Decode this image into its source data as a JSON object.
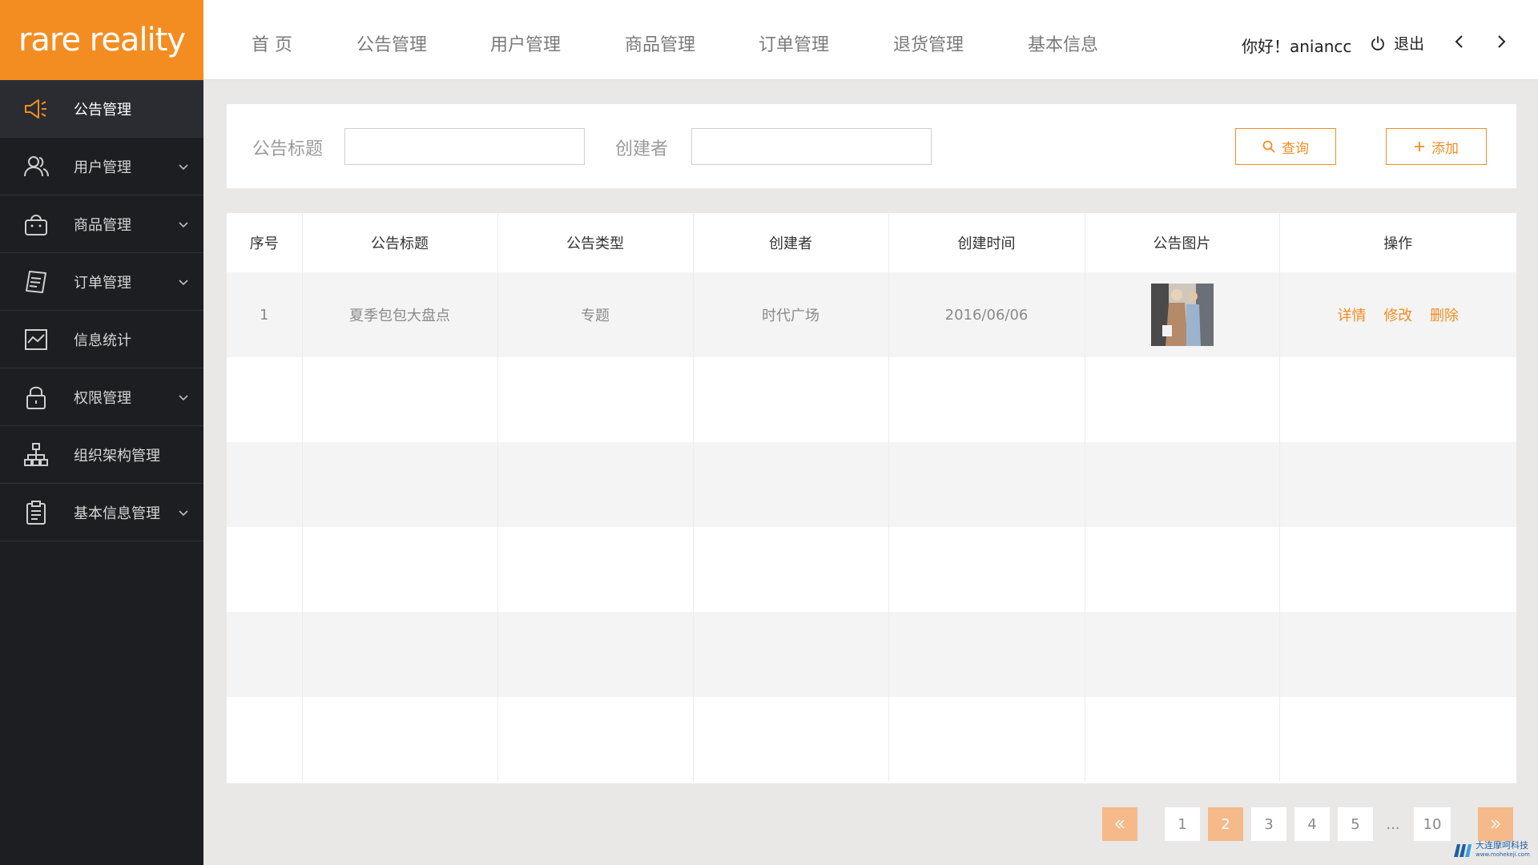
{
  "brand": {
    "logo_text": "rare reality"
  },
  "topnav": {
    "items": [
      "首 页",
      "公告管理",
      "用户管理",
      "商品管理",
      "订单管理",
      "退货管理",
      "基本信息"
    ],
    "greeting": "你好！aniancc",
    "logout_label": "退出"
  },
  "sidebar": {
    "items": [
      {
        "label": "公告管理",
        "icon": "megaphone-icon",
        "expandable": false,
        "active": true
      },
      {
        "label": "用户管理",
        "icon": "users-icon",
        "expandable": true,
        "active": false
      },
      {
        "label": "商品管理",
        "icon": "shopping-bag-icon",
        "expandable": true,
        "active": false
      },
      {
        "label": "订单管理",
        "icon": "receipt-icon",
        "expandable": true,
        "active": false
      },
      {
        "label": "信息统计",
        "icon": "chart-icon",
        "expandable": false,
        "active": false
      },
      {
        "label": "权限管理",
        "icon": "lock-icon",
        "expandable": true,
        "active": false
      },
      {
        "label": "组织架构管理",
        "icon": "org-tree-icon",
        "expandable": false,
        "active": false
      },
      {
        "label": "基本信息管理",
        "icon": "clipboard-icon",
        "expandable": true,
        "active": false
      }
    ]
  },
  "search": {
    "title_label": "公告标题",
    "title_value": "",
    "creator_label": "创建者",
    "creator_value": "",
    "query_button": "查询",
    "add_button": "添加"
  },
  "table": {
    "headers": [
      "序号",
      "公告标题",
      "公告类型",
      "创建者",
      "创建时间",
      "公告图片",
      "操作"
    ],
    "rows": [
      {
        "index": "1",
        "title": "夏季包包大盘点",
        "type": "专题",
        "creator": "时代广场",
        "created": "2016/06/06",
        "has_image": true
      }
    ],
    "actions": [
      "详情",
      "修改",
      "删除"
    ],
    "empty_rows": 5
  },
  "pagination": {
    "pages": [
      "1",
      "2",
      "3",
      "4",
      "5"
    ],
    "ellipsis": "...",
    "last_page": "10",
    "current": "2"
  },
  "watermark": {
    "name": "大连摩呵科技",
    "url": "www.mohekeji.com"
  },
  "colors": {
    "accent": "#f38d22",
    "sidebar_bg": "#1c1e22",
    "page_bg": "#e9e8e6"
  }
}
